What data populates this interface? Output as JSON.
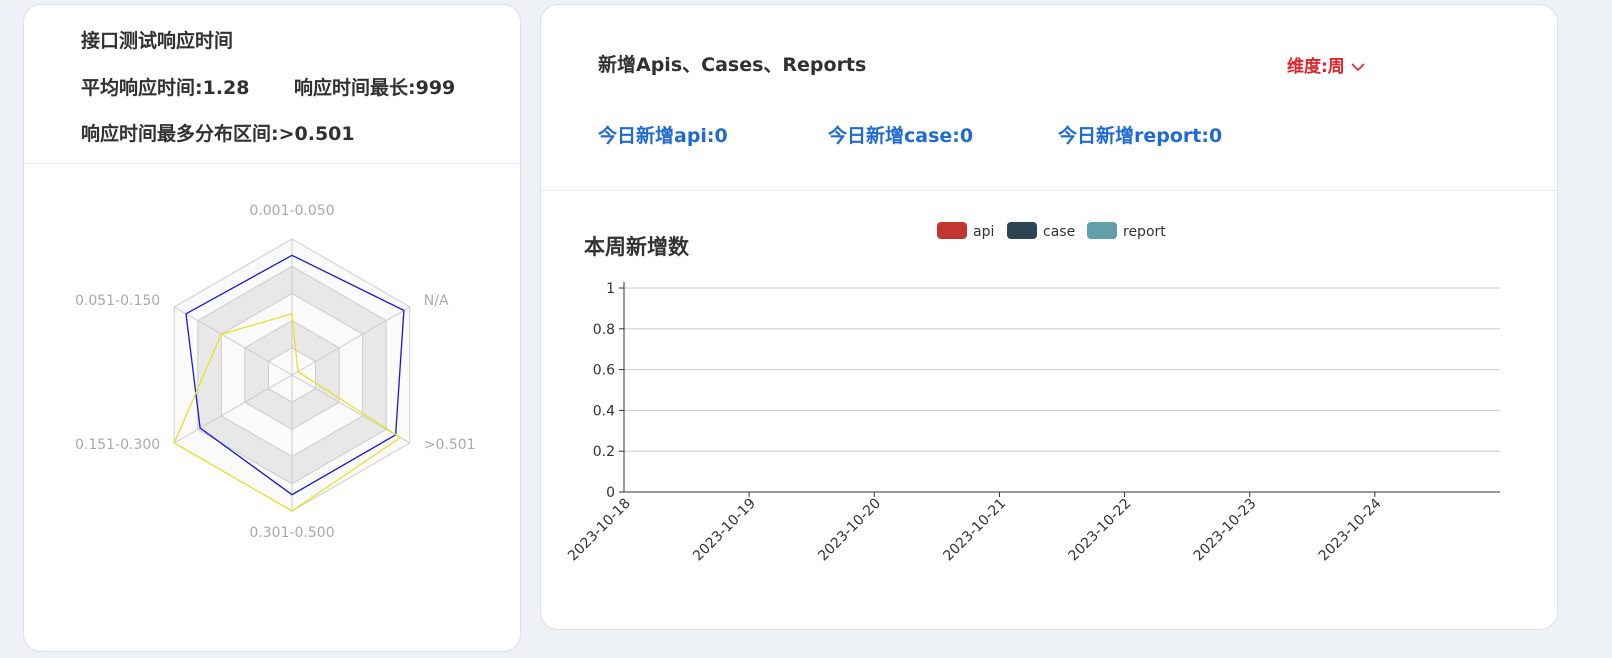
{
  "left_panel": {
    "title": "接口测试响应时间",
    "avg_response": "平均响应时间:1.28",
    "max_response": "响应时间最长:999",
    "most_interval": "响应时间最多分布区间:>0.501"
  },
  "right_panel": {
    "title": "新增Apis、Cases、Reports",
    "dimension_label": "维度:周",
    "today_api": "今日新增api:0",
    "today_case": "今日新增case:0",
    "today_report": "今日新增report:0"
  },
  "colors": {
    "api": "#c23531",
    "case": "#2f4554",
    "report": "#61a0a8",
    "radar_blue": "#1515e0",
    "radar_yellow": "#e6e22a",
    "accent_red": "#e1252b",
    "accent_blue": "#1f6bd1"
  },
  "chart_data": [
    {
      "type": "radar",
      "indicators": [
        "0.001-0.050",
        "N/A",
        ">0.501",
        "0.301-0.500",
        "0.151-0.300",
        "0.051-0.150"
      ],
      "series": [
        {
          "color": "blue",
          "values": [
            0.88,
            0.95,
            0.88,
            0.88,
            0.78,
            0.9
          ]
        },
        {
          "color": "yellow",
          "values": [
            0.45,
            0.05,
            0.92,
            1.0,
            1.0,
            0.6
          ]
        }
      ]
    },
    {
      "type": "bar",
      "title": "本周新增数",
      "legend": [
        "api",
        "case",
        "report"
      ],
      "categories": [
        "2023-10-18",
        "2023-10-19",
        "2023-10-20",
        "2023-10-21",
        "2023-10-22",
        "2023-10-23",
        "2023-10-24"
      ],
      "series": [
        {
          "name": "api",
          "values": [
            0,
            0,
            0,
            0,
            0,
            0,
            0
          ]
        },
        {
          "name": "case",
          "values": [
            0,
            0,
            0,
            0,
            0,
            0,
            0
          ]
        },
        {
          "name": "report",
          "values": [
            0,
            0,
            0,
            0,
            0,
            0,
            0
          ]
        }
      ],
      "y_ticks": [
        "0",
        "0.2",
        "0.4",
        "0.6",
        "0.8",
        "1"
      ],
      "ylim": [
        0,
        1
      ],
      "grid": true,
      "legend_position": "top-center"
    }
  ]
}
